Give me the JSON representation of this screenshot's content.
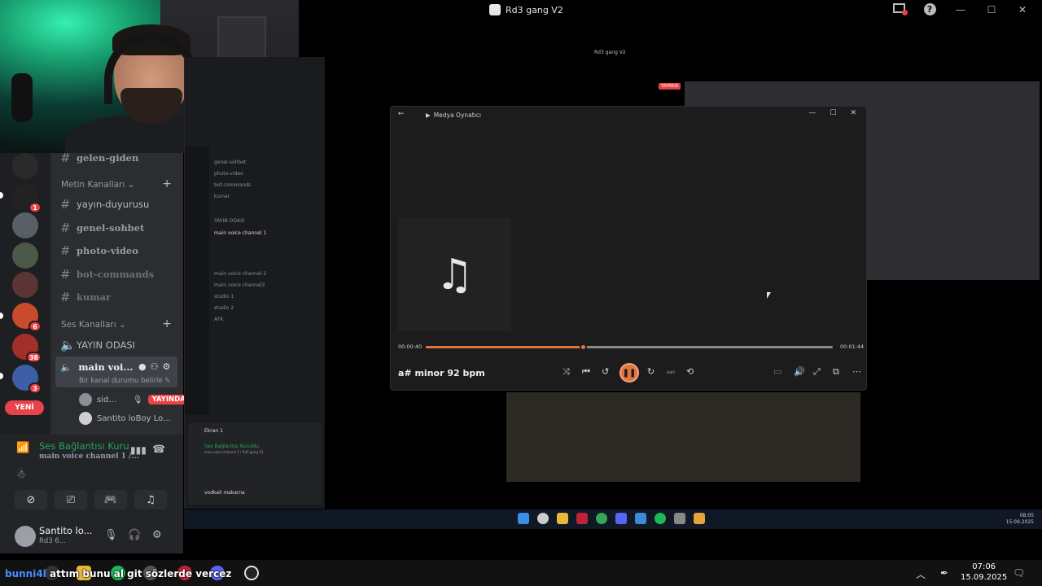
{
  "window": {
    "title": "Rd3 gang V2"
  },
  "webcam": {
    "description_icon": "webcam-feed"
  },
  "servers": {
    "badges": [
      "1",
      "6",
      "38",
      "3"
    ],
    "new_label": "YENİ"
  },
  "channels": {
    "top_channel": "gelen-giden",
    "text_category": "Metin Kanalları",
    "text_channels": [
      "yayın-duyurusu",
      "genel-sohbet",
      "photo-video",
      "bot-commands",
      "kumar"
    ],
    "voice_category": "Ses Kanalları",
    "voice_channels": {
      "stream_room": "YAYIN ODASI",
      "active": "main voi...",
      "active_status": "Bir kanal durumu belirle"
    },
    "members": [
      {
        "name": "sid...",
        "badge": "YAYINDA"
      },
      {
        "name": "Santito loBoy Lo..."
      }
    ]
  },
  "voice_panel": {
    "status": "Ses Bağlantısı Kuru",
    "channel": "main voice channel 1 /..."
  },
  "user_panel": {
    "name": "Santito lo...",
    "sub": "Rd3 6..."
  },
  "media_player": {
    "title": "Medya Oynatıcı",
    "elapsed": "00:00:40",
    "duration": "00:01:44",
    "progress": 0.385,
    "song": "a# minor 92 bpm"
  },
  "share": {
    "title": "Rd3 gang V2",
    "live_label": "YAYINDA"
  },
  "nested_discord": {
    "channels": [
      "genel-sohbet",
      "photo-video",
      "bot-commands",
      "kumar",
      "YAYIN ODASI",
      "main voice channel 1",
      "main voice channel 2",
      "main voice channel3",
      "studio 1",
      "studio 2",
      "AFK"
    ],
    "screen_label": "Ekran 1",
    "voice_status": "Ses Bağlantısı Kuruldu",
    "voice_channel": "main voice channel 1 / Rd3 gang V2",
    "user_name": "vodkali makarna"
  },
  "nested_taskbar": {
    "time": "08:05",
    "date": "15.09.2025"
  },
  "taskbar": {
    "chat_user": "bunni4l",
    "chat_message": "attım bunu al git sözlerde vercez",
    "time": "07:06",
    "date": "15.09.2025"
  }
}
